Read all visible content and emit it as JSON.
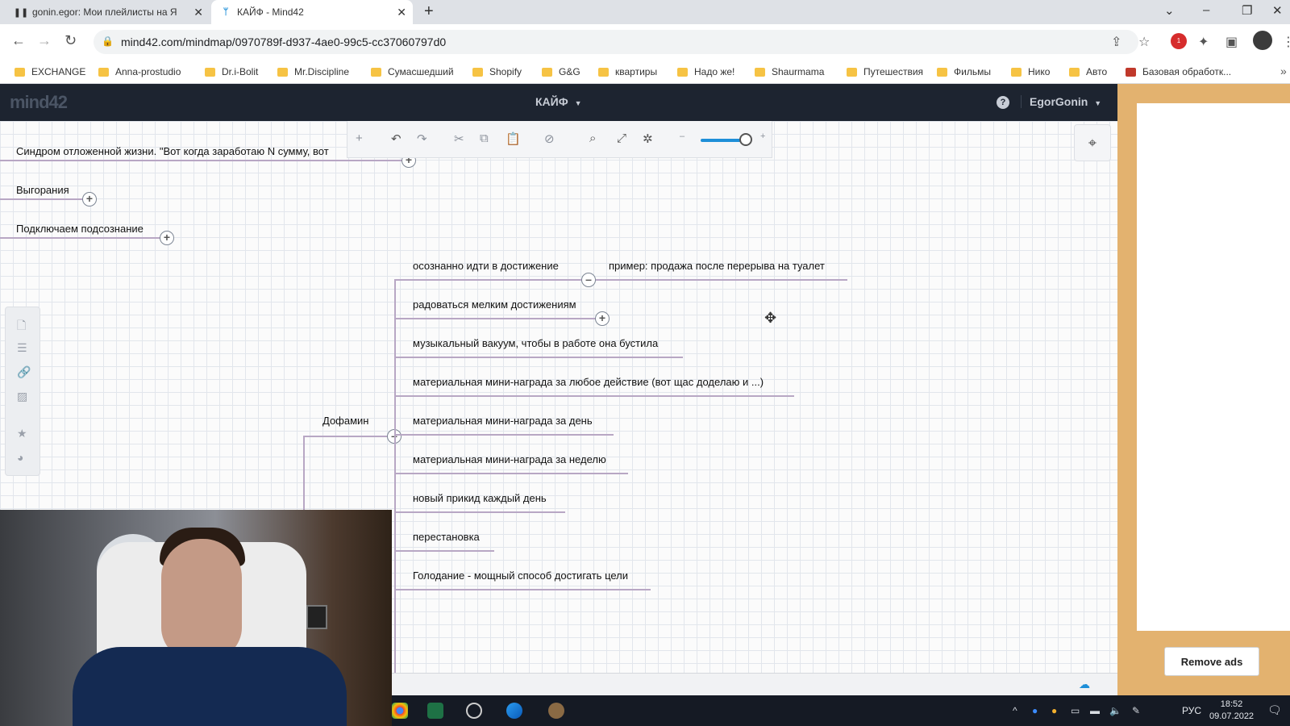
{
  "browser": {
    "tabs": [
      {
        "title": "gonin.egor: Мои плейлисты на Я",
        "icon": "pause-icon"
      },
      {
        "title": "КАЙФ - Mind42",
        "icon": "mind42-icon"
      }
    ],
    "url": "mind42.com/mindmap/0970789f-d937-4ae0-99c5-cc37060797d0",
    "bookmarks": [
      "EXCHANGE",
      "Anna-prostudio",
      "Dr.i-Bolit",
      "Mr.Discipline",
      "Сумасшедший",
      "Shopify",
      "G&G",
      "квартиры",
      "Надо же!",
      "Shaurmama",
      "Путешествия",
      "Фильмы",
      "Нико",
      "Авто",
      "Базовая обработк..."
    ],
    "extension_badge": "1"
  },
  "app": {
    "logo": "mind42",
    "map_title": "КАЙФ",
    "user": "EgorGonin"
  },
  "mindmap": {
    "left_nodes": [
      "Синдром отложенной жизни. \"Вот когда заработаю N сумму, вот",
      "Выгорания",
      "Подключаем подсознание"
    ],
    "parent": "Дофамин",
    "children": [
      "осознанно идти в достижение",
      "радоваться мелким достижениям",
      "музыкальный вакуум, чтобы в работе она бустила",
      "материальная мини-награда за любое действие (вот щас доделаю и ...)",
      "материальная мини-награда за день",
      "материальная мини-награда за неделю",
      "новый прикид каждый день",
      "перестановка",
      "Голодание - мощный способ достигать цели"
    ],
    "grandchild": "пример: продажа после перерыва на туалет"
  },
  "ad": {
    "remove_ads": "Remove ads"
  },
  "taskbar": {
    "language": "РУС",
    "time": "18:52",
    "date": "09.07.2022"
  }
}
